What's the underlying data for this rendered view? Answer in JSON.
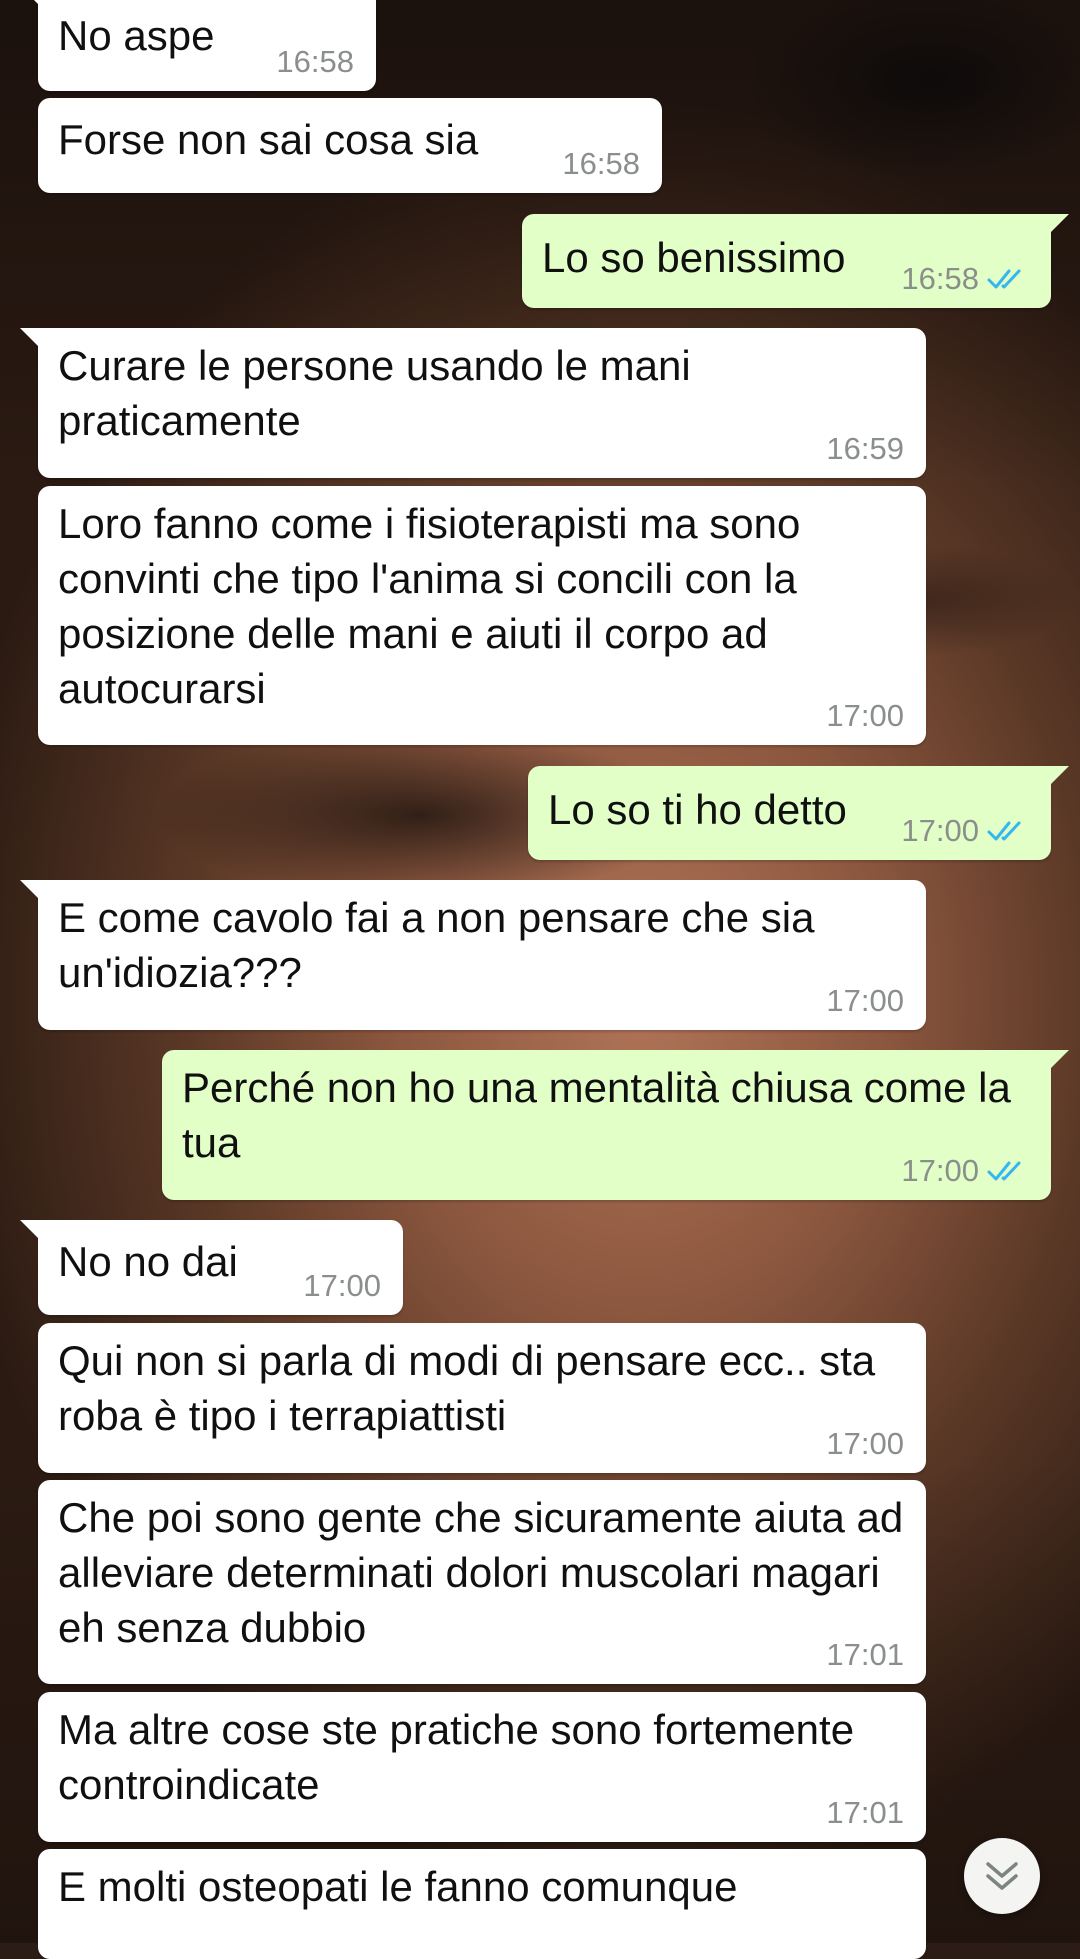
{
  "chat": {
    "messages": [
      {
        "dir": "in",
        "text": "No aspe",
        "time": "16:58"
      },
      {
        "dir": "in",
        "text": "Forse non sai cosa sia",
        "time": "16:58"
      },
      {
        "dir": "out",
        "text": "Lo so benissimo",
        "time": "16:58",
        "status": "read"
      },
      {
        "dir": "in",
        "text": "Curare le persone usando le mani praticamente",
        "time": "16:59"
      },
      {
        "dir": "in",
        "text": "Loro fanno come i fisioterapisti ma sono convinti che tipo l'anima si concili con la posizione delle mani e aiuti il corpo ad autocurarsi",
        "time": "17:00"
      },
      {
        "dir": "out",
        "text": "Lo so ti ho detto",
        "time": "17:00",
        "status": "read"
      },
      {
        "dir": "in",
        "text": "E come cavolo fai a non pensare che sia un'idiozia???",
        "time": "17:00"
      },
      {
        "dir": "out",
        "text": "Perché non ho una mentalità chiusa come la tua",
        "time": "17:00",
        "status": "read"
      },
      {
        "dir": "in",
        "text": "No no dai",
        "time": "17:00"
      },
      {
        "dir": "in",
        "text": "Qui non si parla di modi di pensare ecc.. sta roba è tipo i terrapiattisti",
        "time": "17:00"
      },
      {
        "dir": "in",
        "text": "Che poi sono gente che sicuramente aiuta ad alleviare determinati dolori muscolari magari eh senza dubbio",
        "time": "17:01"
      },
      {
        "dir": "in",
        "text": "Ma altre cose ste pratiche sono fortemente controindicate",
        "time": "17:01"
      },
      {
        "dir": "in",
        "text": "E molti osteopati le fanno comunque",
        "time": ""
      }
    ]
  },
  "colors": {
    "incoming_bubble": "#ffffff",
    "outgoing_bubble": "#e2ffc7",
    "read_ticks": "#34b7f1",
    "timestamp": "#8a8f8c"
  },
  "scroll_button": {
    "icon": "double-chevron-down-icon"
  }
}
